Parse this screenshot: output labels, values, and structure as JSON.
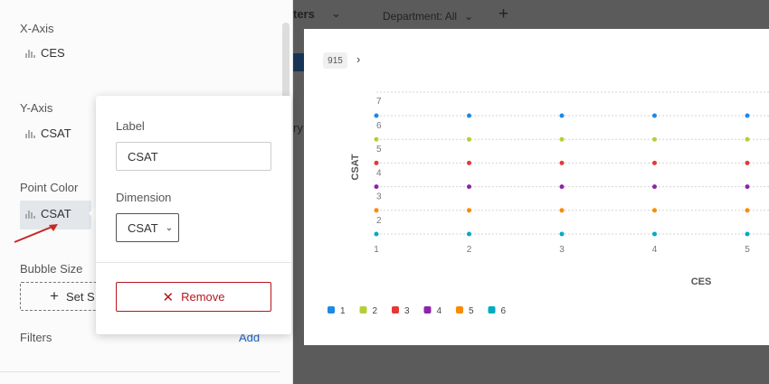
{
  "left_panel": {
    "x_axis": {
      "title": "X-Axis",
      "field": "CES"
    },
    "y_axis": {
      "title": "Y-Axis",
      "field": "CSAT"
    },
    "point_color": {
      "title": "Point Color",
      "field": "CSAT"
    },
    "bubble_size": {
      "title": "Bubble Size",
      "button": "Set S"
    },
    "filters": {
      "title": "Filters",
      "add": "Add"
    }
  },
  "popover": {
    "label_title": "Label",
    "label_value": "CSAT",
    "dimension_title": "Dimension",
    "dimension_value": "CSAT",
    "remove": "Remove"
  },
  "top_bar": {
    "filters_partial": "ters",
    "department": "Department: All",
    "partial_text": "ry"
  },
  "card": {
    "badge": "915"
  },
  "chart_data": {
    "type": "scatter",
    "xlabel": "CES",
    "ylabel": "CSAT",
    "x_ticks": [
      "1",
      "2",
      "3",
      "4",
      "5"
    ],
    "y_ticks": [
      "7",
      "6",
      "5",
      "4",
      "3",
      "2"
    ],
    "xlim": [
      1,
      5
    ],
    "ylim": [
      1,
      7
    ],
    "grid": true,
    "legend_position": "bottom-left",
    "series": [
      {
        "name": "1",
        "color": "#1e88e5",
        "x": [
          1,
          2,
          3,
          4,
          5
        ],
        "y": [
          6,
          6,
          6,
          6,
          6
        ]
      },
      {
        "name": "2",
        "color": "#b8cc3a",
        "x": [
          1,
          2,
          3,
          4,
          5
        ],
        "y": [
          5,
          5,
          5,
          5,
          5
        ]
      },
      {
        "name": "3",
        "color": "#e53935",
        "x": [
          1,
          2,
          3,
          4,
          5
        ],
        "y": [
          4,
          4,
          4,
          4,
          4
        ]
      },
      {
        "name": "4",
        "color": "#8e24aa",
        "x": [
          1,
          2,
          3,
          4,
          5
        ],
        "y": [
          3,
          3,
          3,
          3,
          3
        ]
      },
      {
        "name": "5",
        "color": "#fb8c00",
        "x": [
          1,
          2,
          3,
          4,
          5
        ],
        "y": [
          2,
          2,
          2,
          2,
          2
        ]
      },
      {
        "name": "6",
        "color": "#00acc1",
        "x": [
          1,
          2,
          3,
          4,
          5
        ],
        "y": [
          1,
          1,
          1,
          1,
          1
        ]
      }
    ]
  }
}
